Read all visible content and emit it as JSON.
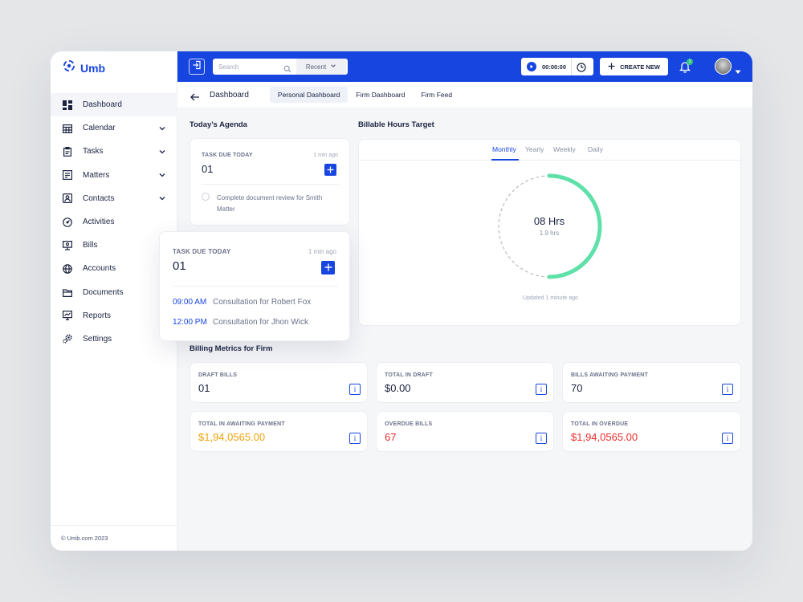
{
  "app": {
    "name": "Umb"
  },
  "colors": {
    "accent": "#1745e0",
    "progress": "#5ee0a8",
    "orange": "#f0a30a",
    "red": "#ef2b2b"
  },
  "sidebar": {
    "items": [
      {
        "label": "Dashboard",
        "icon": "dashboard-icon",
        "active": true,
        "expandable": false
      },
      {
        "label": "Calendar",
        "icon": "calendar-icon",
        "active": false,
        "expandable": true
      },
      {
        "label": "Tasks",
        "icon": "clipboard-icon",
        "active": false,
        "expandable": true
      },
      {
        "label": "Matters",
        "icon": "briefcase-icon",
        "active": false,
        "expandable": true
      },
      {
        "label": "Contacts",
        "icon": "contacts-icon",
        "active": false,
        "expandable": true
      },
      {
        "label": "Activities",
        "icon": "gauge-icon",
        "active": false,
        "expandable": false
      },
      {
        "label": "Bills",
        "icon": "bill-icon",
        "active": false,
        "expandable": false
      },
      {
        "label": "Accounts",
        "icon": "globe-icon",
        "active": false,
        "expandable": false
      },
      {
        "label": "Documents",
        "icon": "documents-icon",
        "active": false,
        "expandable": false
      },
      {
        "label": "Reports",
        "icon": "monitor-icon",
        "active": false,
        "expandable": false
      },
      {
        "label": "Settings",
        "icon": "gear-icon",
        "active": false,
        "expandable": false
      }
    ],
    "footer": "© Umb.com 2023"
  },
  "topbar": {
    "search_placeholder": "Search",
    "recent_label": "Recent",
    "timer": "00:00:00",
    "create_label": "CREATE NEW",
    "notification_count": "3"
  },
  "subnav": {
    "title": "Dashboard",
    "tabs": [
      "Personal Dashboard",
      "Firm Dashboard",
      "Firm Feed"
    ],
    "active_tab": 0
  },
  "agenda": {
    "title": "Today’s Agenda",
    "card": {
      "caption": "TASK DUE TODAY",
      "time_ago": "1 min ago",
      "count": "01",
      "task": "Complete document review for Smith Matter"
    },
    "popup": {
      "caption": "TASK DUE TODAY",
      "time_ago": "1 min ago",
      "count": "01",
      "items": [
        {
          "time": "09:00 AM",
          "text": "Consultation for Robert Fox"
        },
        {
          "time": "12:00 PM",
          "text": "Consultation for Jhon Wick"
        }
      ]
    }
  },
  "billable": {
    "title": "Billable Hours Target",
    "tabs": [
      "Monthly",
      "Yearly",
      "Weekly",
      "Daily"
    ],
    "active_tab": 0,
    "target": "08 Hrs",
    "logged": "1.9 hrs",
    "progress_fraction": 0.5,
    "updated": "Updated 1 minute ago"
  },
  "billing": {
    "title": "Billing Metrics for Firm",
    "metrics": [
      {
        "label": "DRAFT BILLS",
        "value": "01",
        "tone": "default"
      },
      {
        "label": "TOTAL IN DRAFT",
        "value": "$0.00",
        "tone": "default"
      },
      {
        "label": "BILLS AWAITING PAYMENT",
        "value": "70",
        "tone": "default"
      },
      {
        "label": "TOTAL IN AWAITING PAYMENT",
        "value": "$1,94,0565.00",
        "tone": "orange"
      },
      {
        "label": "OVERDUE BILLS",
        "value": "67",
        "tone": "red"
      },
      {
        "label": "TOTAL IN OVERDUE",
        "value": "$1,94,0565.00",
        "tone": "red"
      }
    ]
  }
}
